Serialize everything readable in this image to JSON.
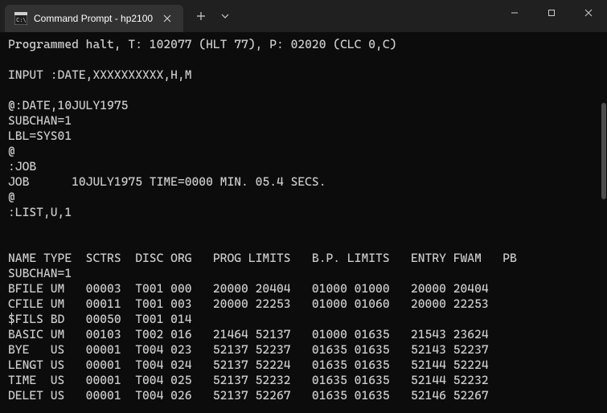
{
  "window": {
    "title": "Command Prompt - hp2100"
  },
  "terminal": {
    "lines": [
      "Programmed halt, T: 102077 (HLT 77), P: 02020 (CLC 0,C)",
      "",
      "INPUT :DATE,XXXXXXXXXX,H,M",
      "",
      "@:DATE,10JULY1975",
      "SUBCHAN=1",
      "LBL=SYS01",
      "@",
      ":JOB",
      "JOB      10JULY1975 TIME=0000 MIN. 05.4 SECS.",
      "@",
      ":LIST,U,1",
      "",
      "",
      "NAME TYPE  SCTRS  DISC ORG   PROG LIMITS   B.P. LIMITS   ENTRY FWAM   PB",
      "SUBCHAN=1",
      "BFILE UM   00003  T001 000   20000 20404   01000 01000   20000 20404",
      "CFILE UM   00011  T001 003   20000 22253   01000 01060   20000 22253",
      "$FILS BD   00050  T001 014",
      "BASIC UM   00103  T002 016   21464 52137   01000 01635   21543 23624",
      "BYE   US   00001  T004 023   52137 52237   01635 01635   52143 52237",
      "LENGT US   00001  T004 024   52137 52224   01635 01635   52144 52224",
      "TIME  US   00001  T004 025   52137 52232   01635 01635   52144 52232",
      "DELET US   00001  T004 026   52137 52267   01635 01635   52146 52267"
    ]
  }
}
